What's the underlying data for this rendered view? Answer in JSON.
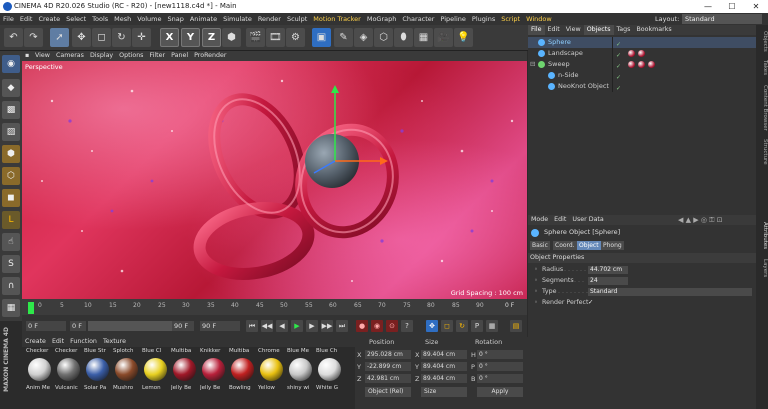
{
  "window": {
    "title": "CINEMA 4D R20.026 Studio (RC - R20) - [new1118.c4d *] - Main",
    "minimize": "—",
    "maximize": "☐",
    "close": "✕"
  },
  "menu": [
    "File",
    "Edit",
    "Create",
    "Select",
    "Tools",
    "Mesh",
    "Volume",
    "Snap",
    "Animate",
    "Simulate",
    "Render",
    "Sculpt",
    "Motion Tracker",
    "MoGraph",
    "Character",
    "Pipeline",
    "Plugins",
    "Script",
    "Window"
  ],
  "layout": {
    "label": "Layout:",
    "value": "Standard"
  },
  "toolbar_axes": [
    "X",
    "Y",
    "Z"
  ],
  "viewport": {
    "menu": [
      "View",
      "Cameras",
      "Display",
      "Options",
      "Filter",
      "Panel",
      "ProRender"
    ],
    "label": "Perspective",
    "grid_spacing": "Grid Spacing : 100 cm"
  },
  "timeline": {
    "ticks": [
      "0",
      "5",
      "10",
      "15",
      "20",
      "25",
      "30",
      "35",
      "40",
      "45",
      "50",
      "55",
      "60",
      "65",
      "70",
      "75",
      "80",
      "85",
      "90"
    ],
    "end_label": "0 F",
    "start": "0 F",
    "current": "0 F",
    "end": "90 F",
    "max": "90 F"
  },
  "materials": {
    "menu": [
      "Create",
      "Edit",
      "Function",
      "Texture"
    ],
    "items": [
      {
        "top": "Checker",
        "bottom": "Anim Me",
        "color": "#d0d0d0"
      },
      {
        "top": "Checker",
        "bottom": "Vulcanic",
        "color": "#707070"
      },
      {
        "top": "Blue Str",
        "bottom": "Solar Pa",
        "color": "#3a5ea8"
      },
      {
        "top": "Splotch",
        "bottom": "Mushro",
        "color": "#8a4a2a"
      },
      {
        "top": "Blue Cl",
        "bottom": "Lemon",
        "color": "#e8d020"
      },
      {
        "top": "Multiba",
        "bottom": "Jelly Be",
        "color": "#a01828"
      },
      {
        "top": "Knikker",
        "bottom": "Jelly Be",
        "color": "#b8203a"
      },
      {
        "top": "Multiba",
        "bottom": "Bowling",
        "color": "#c02020"
      },
      {
        "top": "Chrome",
        "bottom": "Yellow",
        "color": "#e8c010"
      },
      {
        "top": "Blue Me",
        "bottom": "shiny wi",
        "color": "#c8c8c8"
      },
      {
        "top": "Blue Ch",
        "bottom": "White G",
        "color": "#dcdcdc"
      }
    ]
  },
  "coords": {
    "headers": [
      "Position",
      "Size",
      "Rotation"
    ],
    "rows": [
      {
        "axis": "X",
        "pos": "295.028 cm",
        "size_axis": "X",
        "size": "89.404 cm",
        "rot_axis": "H",
        "rot": "0 °"
      },
      {
        "axis": "Y",
        "pos": "-22.899 cm",
        "size_axis": "Y",
        "size": "89.404 cm",
        "rot_axis": "P",
        "rot": "0 °"
      },
      {
        "axis": "Z",
        "pos": "42.981 cm",
        "size_axis": "Z",
        "size": "89.404 cm",
        "rot_axis": "B",
        "rot": "0 °"
      }
    ],
    "mode": "Object (Rel)",
    "size_mode": "Size",
    "apply": "Apply"
  },
  "objects": {
    "menu": [
      "File",
      "Edit",
      "View",
      "Objects",
      "Tags",
      "Bookmarks"
    ],
    "rows": [
      {
        "name": "Sphere",
        "icon": "#5ab4ff",
        "indent": 0,
        "selected": true
      },
      {
        "name": "Landscape",
        "icon": "#5ab4ff",
        "indent": 0,
        "selected": false
      },
      {
        "name": "Sweep",
        "icon": "#6fd46f",
        "indent": 0,
        "selected": false
      },
      {
        "name": "n-Side",
        "icon": "#5ab4ff",
        "indent": 10,
        "selected": false
      },
      {
        "name": "NeoKnot Object",
        "icon": "#5ab4ff",
        "indent": 10,
        "selected": false
      }
    ]
  },
  "attributes": {
    "menu": [
      "Mode",
      "Edit",
      "User Data"
    ],
    "title": "Sphere Object [Sphere]",
    "tabs": [
      "Basic",
      "Coord.",
      "Object",
      "Phong"
    ],
    "active_tab": "Object",
    "section": "Object Properties",
    "fields": [
      {
        "label": "Radius",
        "value": "44.702 cm"
      },
      {
        "label": "Segments",
        "value": "24"
      },
      {
        "label": "Type",
        "value": "Standard"
      },
      {
        "label": "Render Perfect",
        "value": "✓"
      }
    ]
  },
  "side_tabs": [
    "Objects",
    "Takes",
    "Content Browser",
    "Structure",
    "Attributes",
    "Layers"
  ],
  "brand": "MAXON CINEMA 4D"
}
